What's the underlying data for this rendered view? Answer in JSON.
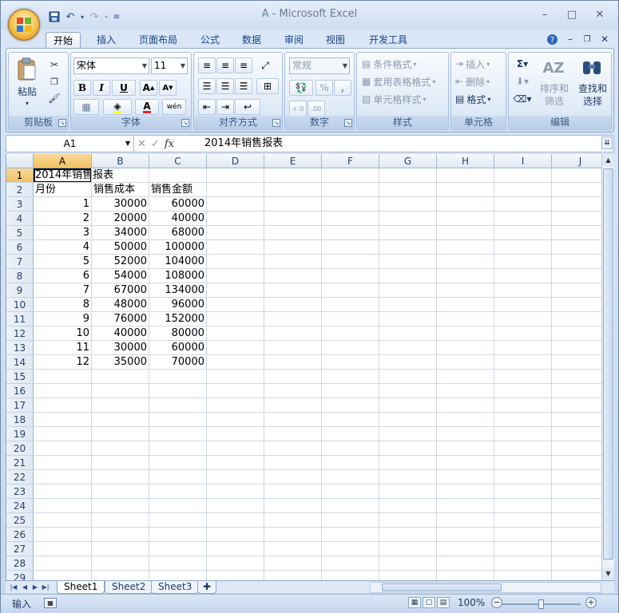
{
  "window": {
    "title": "A - Microsoft Excel",
    "minimize": "–",
    "maximize": "□",
    "close": "✕"
  },
  "tabs": [
    "开始",
    "插入",
    "页面布局",
    "公式",
    "数据",
    "审阅",
    "视图",
    "开发工具"
  ],
  "ribbon": {
    "clipboard": {
      "paste": "粘贴",
      "label": "剪贴板"
    },
    "font": {
      "name": "宋体",
      "size": "11",
      "bold": "B",
      "italic": "I",
      "underline": "U",
      "label": "字体"
    },
    "alignment": {
      "label": "对齐方式"
    },
    "number": {
      "format": "常规",
      "percent": "%",
      "comma": ",",
      "inc_decimal": "+.0",
      "dec_decimal": ".00",
      "label": "数字"
    },
    "styles": {
      "conditional": "条件格式",
      "table": "套用表格格式",
      "cell": "单元格样式",
      "label": "样式"
    },
    "cells": {
      "insert": "插入",
      "delete": "删除",
      "format": "格式",
      "label": "单元格"
    },
    "editing": {
      "sort_1": "排序和",
      "sort_2": "筛选",
      "find_1": "查找和",
      "find_2": "选择",
      "label": "编辑"
    }
  },
  "formula_bar": {
    "name_box": "A1",
    "content": "2014年销售报表",
    "fx": "fx"
  },
  "columns": [
    "A",
    "B",
    "C",
    "D",
    "E",
    "F",
    "G",
    "H",
    "I",
    "J"
  ],
  "rows": [
    "1",
    "2",
    "3",
    "4",
    "5",
    "6",
    "7",
    "8",
    "9",
    "10",
    "11",
    "12",
    "13",
    "14",
    "15",
    "16",
    "17",
    "18",
    "19",
    "20",
    "21",
    "22",
    "23",
    "24",
    "25",
    "26",
    "27",
    "28",
    "29"
  ],
  "sheet": {
    "title": "2014年销售报表",
    "headers": [
      "月份",
      "销售成本",
      "销售金额"
    ],
    "data": [
      [
        "1",
        "30000",
        "60000"
      ],
      [
        "2",
        "20000",
        "40000"
      ],
      [
        "3",
        "34000",
        "68000"
      ],
      [
        "4",
        "50000",
        "100000"
      ],
      [
        "5",
        "52000",
        "104000"
      ],
      [
        "6",
        "54000",
        "108000"
      ],
      [
        "7",
        "67000",
        "134000"
      ],
      [
        "8",
        "48000",
        "96000"
      ],
      [
        "9",
        "76000",
        "152000"
      ],
      [
        "10",
        "40000",
        "80000"
      ],
      [
        "11",
        "30000",
        "60000"
      ],
      [
        "12",
        "35000",
        "70000"
      ]
    ]
  },
  "sheet_tabs": [
    "Sheet1",
    "Sheet2",
    "Sheet3"
  ],
  "status": {
    "mode": "输入",
    "zoom": "100%"
  },
  "colors": {
    "accent": "#15428b",
    "selection_header": "#f1c15f"
  }
}
